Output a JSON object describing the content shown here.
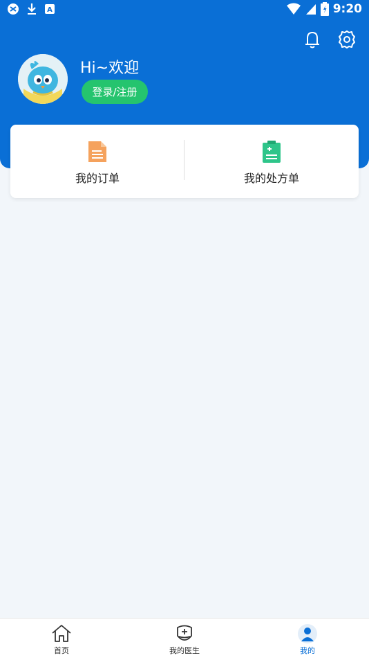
{
  "status_bar": {
    "time": "9:20"
  },
  "header": {
    "greeting": "Hi~欢迎",
    "login_label": "登录/注册",
    "bell_icon": "bell-icon",
    "settings_icon": "gear-icon"
  },
  "quick_actions": [
    {
      "label": "我的订单",
      "icon": "document-icon"
    },
    {
      "label": "我的处方单",
      "icon": "prescription-icon"
    }
  ],
  "tabs": [
    {
      "label": "首页",
      "icon": "home-icon"
    },
    {
      "label": "我的医生",
      "icon": "doctor-icon"
    },
    {
      "label": "我的",
      "icon": "user-icon",
      "active": true
    }
  ],
  "colors": {
    "primary": "#0a6fd6",
    "login_button": "#25c46e",
    "order_icon": "#f5a25d",
    "prescription_icon": "#2ec58a",
    "background": "#f2f6fa"
  }
}
